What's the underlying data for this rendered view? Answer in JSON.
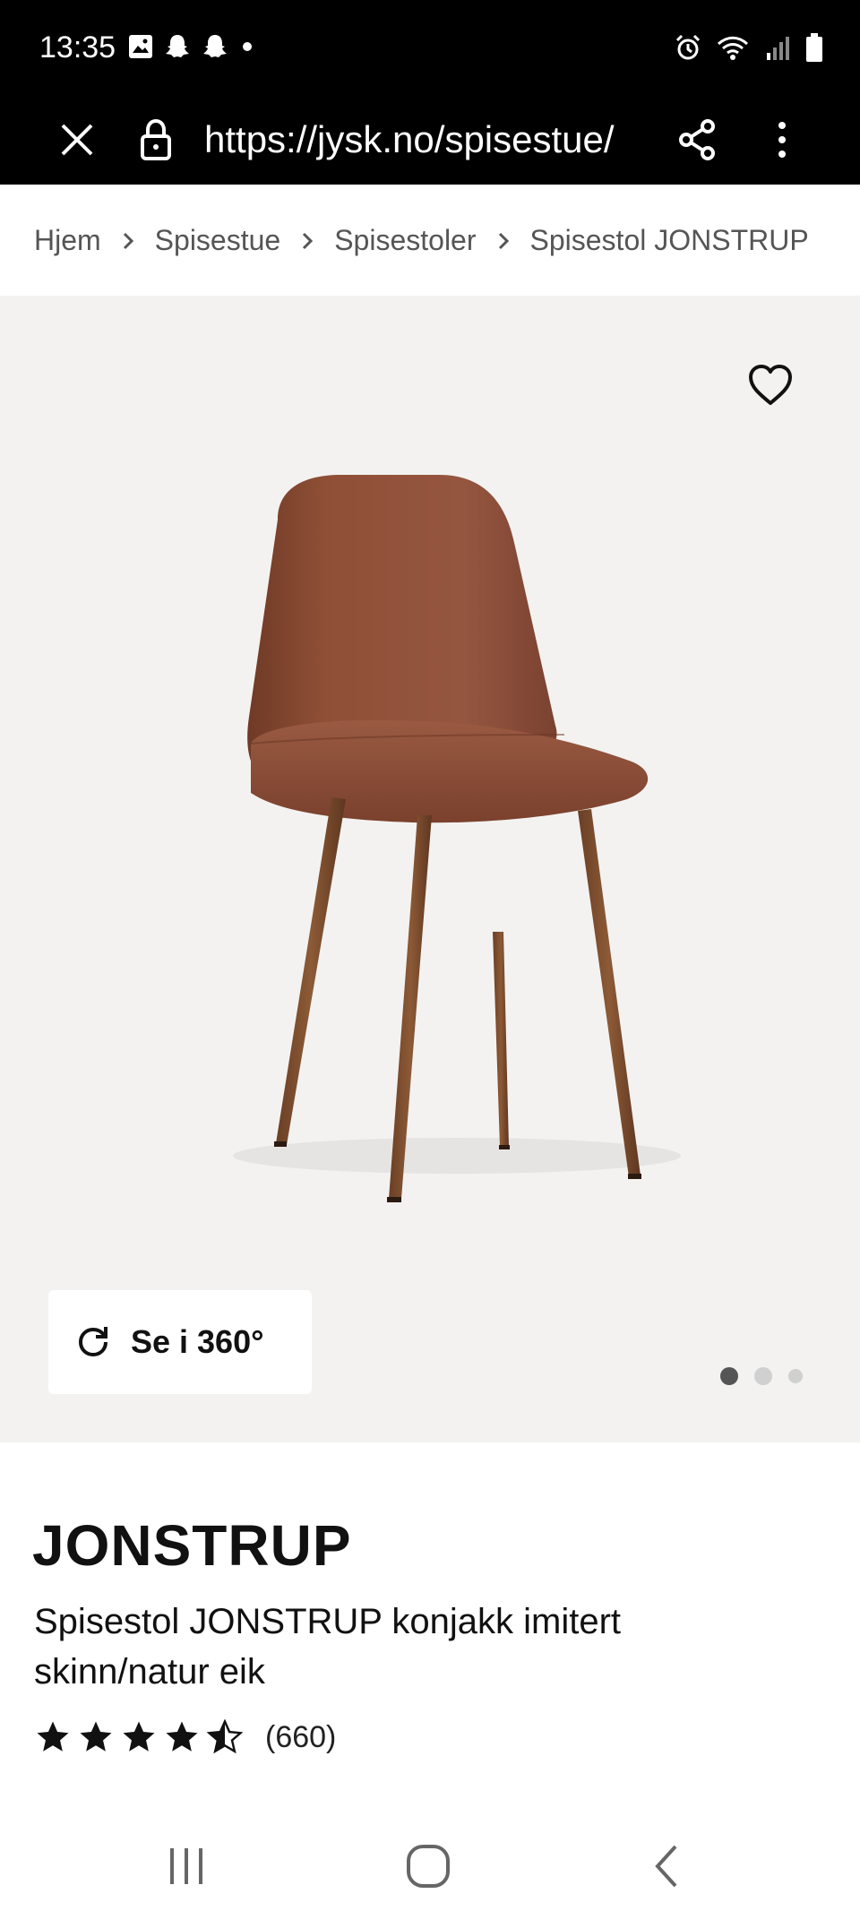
{
  "status_bar": {
    "time": "13:35",
    "left_icons": [
      "gallery-icon",
      "snapchat-icon",
      "snapchat-icon",
      "dot-icon"
    ],
    "right_icons": [
      "alarm-icon",
      "wifi-icon",
      "signal-icon",
      "battery-icon"
    ]
  },
  "url_bar": {
    "url": "https://jysk.no/spisestue/",
    "icons": [
      "close-icon",
      "lock-icon",
      "share-icon",
      "more-icon"
    ]
  },
  "breadcrumb": [
    {
      "label": "Hjem"
    },
    {
      "label": "Spisestue"
    },
    {
      "label": "Spisestoler"
    },
    {
      "label": "Spisestol JONSTRUP"
    }
  ],
  "hero": {
    "view360_label": "Se i 360°",
    "image_count": 3,
    "active_image_index": 0
  },
  "product": {
    "title": "JONSTRUP",
    "subtitle": "Spisestol JONSTRUP konjakk imitert skinn/natur eik",
    "rating": 4.5,
    "rating_max": 5,
    "review_count": "(660)"
  },
  "colors": {
    "bar_bg": "#000000",
    "hero_bg": "#f3f2f1",
    "chair_leather": "#8a4a32",
    "chair_wood": "#7a4a2e"
  }
}
